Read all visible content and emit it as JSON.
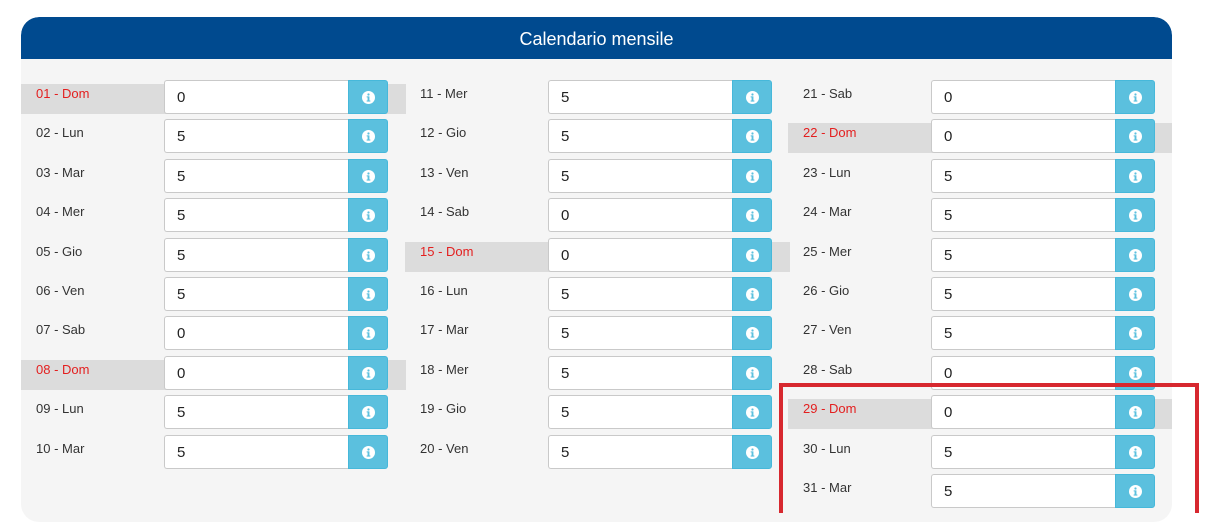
{
  "header": {
    "title": "Calendario mensile"
  },
  "colors": {
    "header_bg": "#004a8f",
    "sunday_text": "#e31f1f",
    "info_button": "#5bc0de",
    "highlight": "#d7282f"
  },
  "info_icon": "info-circle-icon",
  "days": [
    {
      "label": "01 - Dom",
      "value": "0",
      "sunday": true
    },
    {
      "label": "02 - Lun",
      "value": "5",
      "sunday": false
    },
    {
      "label": "03 - Mar",
      "value": "5",
      "sunday": false
    },
    {
      "label": "04 - Mer",
      "value": "5",
      "sunday": false
    },
    {
      "label": "05 - Gio",
      "value": "5",
      "sunday": false
    },
    {
      "label": "06 - Ven",
      "value": "5",
      "sunday": false
    },
    {
      "label": "07 - Sab",
      "value": "0",
      "sunday": false
    },
    {
      "label": "08 - Dom",
      "value": "0",
      "sunday": true
    },
    {
      "label": "09 - Lun",
      "value": "5",
      "sunday": false
    },
    {
      "label": "10 - Mar",
      "value": "5",
      "sunday": false
    },
    {
      "label": "11 - Mer",
      "value": "5",
      "sunday": false
    },
    {
      "label": "12 - Gio",
      "value": "5",
      "sunday": false
    },
    {
      "label": "13 - Ven",
      "value": "5",
      "sunday": false
    },
    {
      "label": "14 - Sab",
      "value": "0",
      "sunday": false
    },
    {
      "label": "15 - Dom",
      "value": "0",
      "sunday": true
    },
    {
      "label": "16 - Lun",
      "value": "5",
      "sunday": false
    },
    {
      "label": "17 - Mar",
      "value": "5",
      "sunday": false
    },
    {
      "label": "18 - Mer",
      "value": "5",
      "sunday": false
    },
    {
      "label": "19 - Gio",
      "value": "5",
      "sunday": false
    },
    {
      "label": "20 - Ven",
      "value": "5",
      "sunday": false
    },
    {
      "label": "21 - Sab",
      "value": "0",
      "sunday": false
    },
    {
      "label": "22 - Dom",
      "value": "0",
      "sunday": true
    },
    {
      "label": "23 - Lun",
      "value": "5",
      "sunday": false
    },
    {
      "label": "24 - Mar",
      "value": "5",
      "sunday": false
    },
    {
      "label": "25 - Mer",
      "value": "5",
      "sunday": false
    },
    {
      "label": "26 - Gio",
      "value": "5",
      "sunday": false
    },
    {
      "label": "27 - Ven",
      "value": "5",
      "sunday": false
    },
    {
      "label": "28 - Sab",
      "value": "0",
      "sunday": false
    },
    {
      "label": "29 - Dom",
      "value": "0",
      "sunday": true
    },
    {
      "label": "30 - Lun",
      "value": "5",
      "sunday": false
    },
    {
      "label": "31 - Mar",
      "value": "5",
      "sunday": false
    }
  ]
}
